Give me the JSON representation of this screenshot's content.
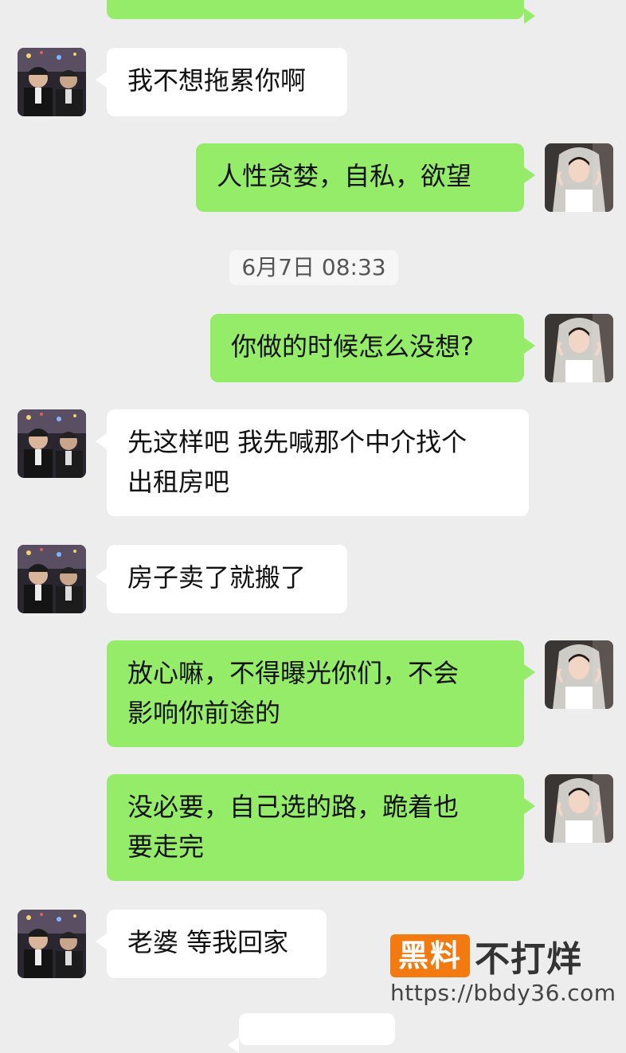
{
  "messages": [
    {
      "side": "out",
      "lines": [
        ""
      ]
    },
    {
      "side": "in",
      "lines": [
        "我不想拖累你啊"
      ]
    },
    {
      "side": "out",
      "lines": [
        "人性贪婪，自私，欲望"
      ]
    },
    {
      "side": "out",
      "lines": [
        "你做的时候怎么没想?"
      ]
    },
    {
      "side": "in",
      "lines": [
        "先这样吧 我先喊那个中介找个",
        "出租房吧"
      ]
    },
    {
      "side": "in",
      "lines": [
        "房子卖了就搬了"
      ]
    },
    {
      "side": "out",
      "lines": [
        "放心嘛，不得曝光你们，不会",
        "影响你前途的"
      ]
    },
    {
      "side": "out",
      "lines": [
        "没必要，自己选的路，跪着也",
        "要走完"
      ]
    },
    {
      "side": "in",
      "lines": [
        "老婆 等我回家"
      ]
    }
  ],
  "timestamp": "6月7日 08:33",
  "watermark": {
    "badge": "黑料",
    "name": "不打烊",
    "url": "https://bbdy36.com"
  },
  "colors": {
    "background": "#ededed",
    "outgoing_bubble": "#95ec69",
    "incoming_bubble": "#ffffff",
    "watermark_badge": "#f27a10"
  },
  "icons": {
    "incoming_avatar": "man-in-suit-avatar",
    "outgoing_avatar": "bride-avatar"
  }
}
